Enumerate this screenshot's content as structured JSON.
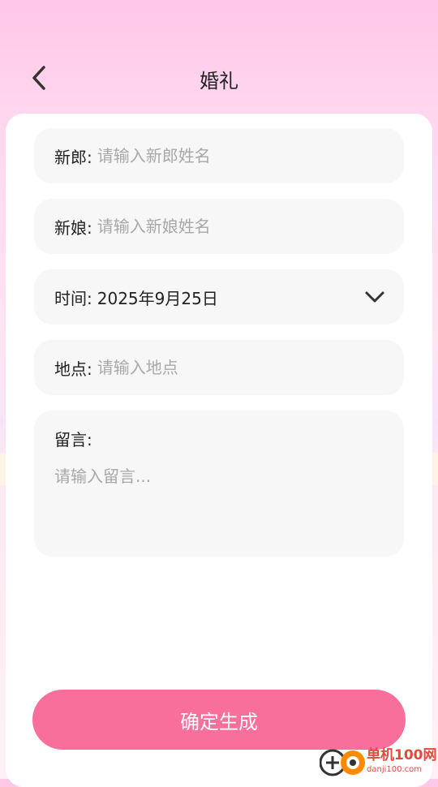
{
  "header": {
    "title": "婚礼"
  },
  "form": {
    "groom": {
      "label": "新郎:",
      "placeholder": "请输入新郎姓名"
    },
    "bride": {
      "label": "新娘:",
      "placeholder": "请输入新娘姓名"
    },
    "time": {
      "label": "时间:",
      "value": "2025年9月25日"
    },
    "location": {
      "label": "地点:",
      "placeholder": "请输入地点"
    },
    "message": {
      "label": "留言:",
      "placeholder": "请输入留言..."
    }
  },
  "confirm_button": {
    "label": "确定生成"
  },
  "watermark": {
    "title": "单机100网",
    "url": "danji100.com"
  },
  "colors": {
    "accent": "#f96f9b",
    "field_bg": "#f7f7f7",
    "placeholder": "#a8a8a8",
    "watermark": "#e8483c"
  },
  "icons": {
    "back": "chevron-left-icon",
    "dropdown": "chevron-down-icon"
  }
}
